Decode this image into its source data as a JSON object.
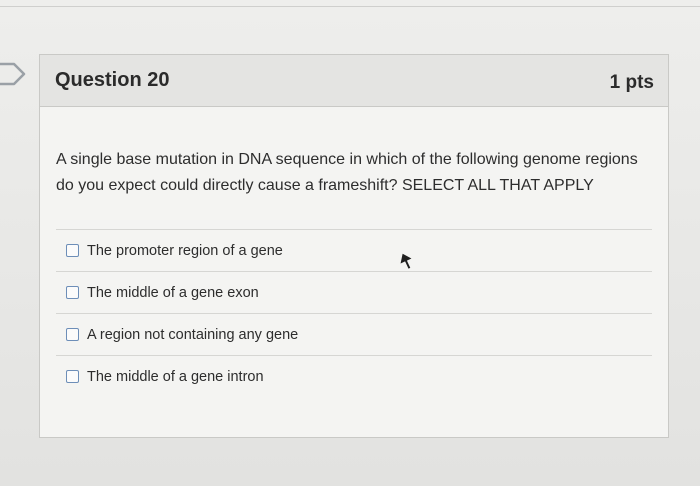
{
  "question": {
    "title": "Question 20",
    "points": "1 pts",
    "text": "A single base mutation in DNA sequence in which of the following genome regions do you expect could directly cause a frameshift? SELECT ALL THAT APPLY",
    "answers": [
      {
        "label": "The promoter region of a gene",
        "checked": false
      },
      {
        "label": "The middle of a gene exon",
        "checked": false
      },
      {
        "label": "A region not containing any gene",
        "checked": false
      },
      {
        "label": "The middle of a gene intron",
        "checked": false
      }
    ]
  },
  "icons": {
    "flag": "flag-icon",
    "cursor": "mouse-cursor-icon"
  },
  "colors": {
    "checkbox_border": "#6d8eb8",
    "header_bg": "#e4e4e2",
    "card_bg": "#f4f4f2"
  }
}
